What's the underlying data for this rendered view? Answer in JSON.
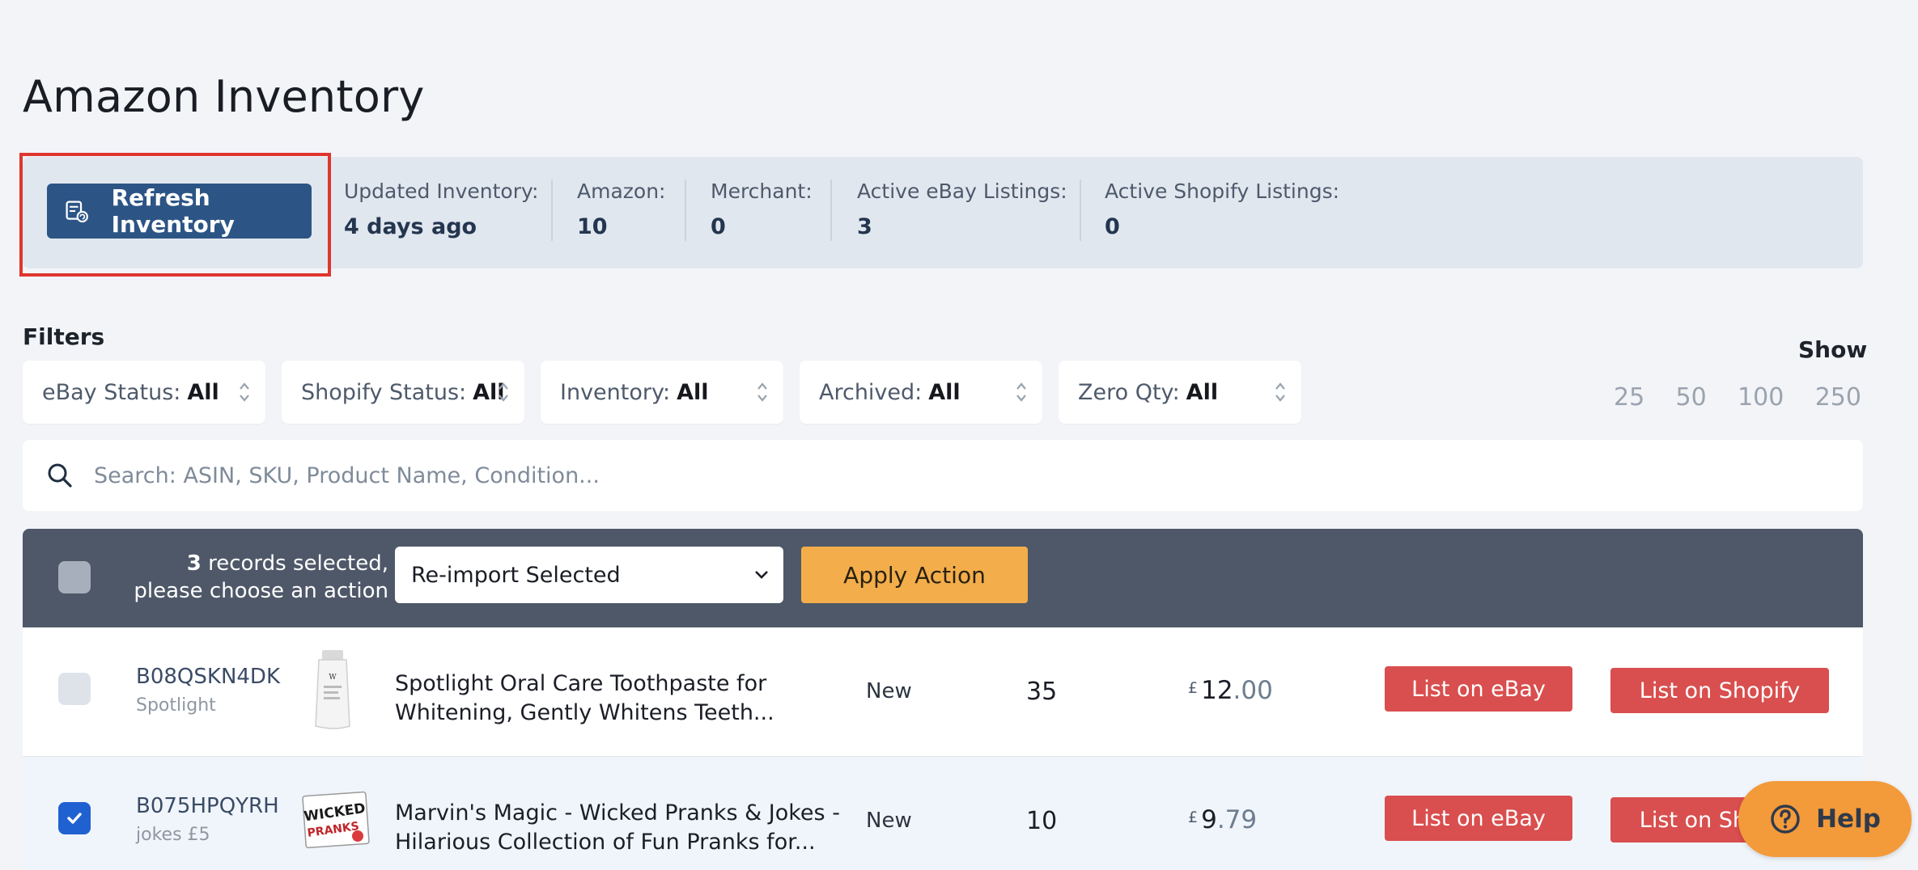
{
  "page": {
    "title": "Amazon Inventory"
  },
  "stats": {
    "refresh_label": "Refresh Inventory",
    "items": [
      {
        "label": "Updated Inventory:",
        "value": "4 days ago"
      },
      {
        "label": "Amazon:",
        "value": "10"
      },
      {
        "label": "Merchant:",
        "value": "0"
      },
      {
        "label": "Active eBay Listings:",
        "value": "3"
      },
      {
        "label": "Active Shopify Listings:",
        "value": "0"
      }
    ]
  },
  "filters": {
    "heading": "Filters",
    "items": [
      {
        "label": "eBay Status:",
        "value": "All"
      },
      {
        "label": "Shopify Status:",
        "value": "All"
      },
      {
        "label": "Inventory:",
        "value": "All"
      },
      {
        "label": "Archived:",
        "value": "All"
      },
      {
        "label": "Zero Qty:",
        "value": "All"
      }
    ]
  },
  "show": {
    "label": "Show",
    "options": [
      "25",
      "50",
      "100",
      "250"
    ]
  },
  "search": {
    "placeholder": "Search: ASIN, SKU, Product Name, Condition...",
    "value": ""
  },
  "bulk": {
    "count": "3",
    "text_line1": " records selected,",
    "text_line2": "please choose an action",
    "selected_action": "Re-import Selected",
    "apply_label": "Apply Action"
  },
  "rows": [
    {
      "asin": "B08QSKN4DK",
      "sub": "Spotlight",
      "name": "Spotlight Oral Care Toothpaste for Whitening, Gently Whitens Teeth...",
      "condition": "New",
      "qty": "35",
      "currency": "£",
      "price_int": "12",
      "price_dec": ".00",
      "ebay_label": "List on eBay",
      "shopify_label": "List on Shopify",
      "checked": false
    },
    {
      "asin": "B075HPQYRH",
      "sub": "jokes £5",
      "name": "Marvin's Magic - Wicked Pranks & Jokes - Hilarious Collection of Fun Pranks for...",
      "condition": "New",
      "qty": "10",
      "currency": "£",
      "price_int": "9",
      "price_dec": ".79",
      "ebay_label": "List on eBay",
      "shopify_label": "List on Shopify",
      "checked": true
    }
  ],
  "help": {
    "label": "Help"
  },
  "colors": {
    "primary": "#2c5585",
    "highlight": "#e0352f",
    "action_bar": "#4e5868",
    "apply": "#f3ae4b",
    "list_button": "#d94e4e",
    "help": "#f39a3a",
    "checkbox_on": "#2061d1"
  }
}
